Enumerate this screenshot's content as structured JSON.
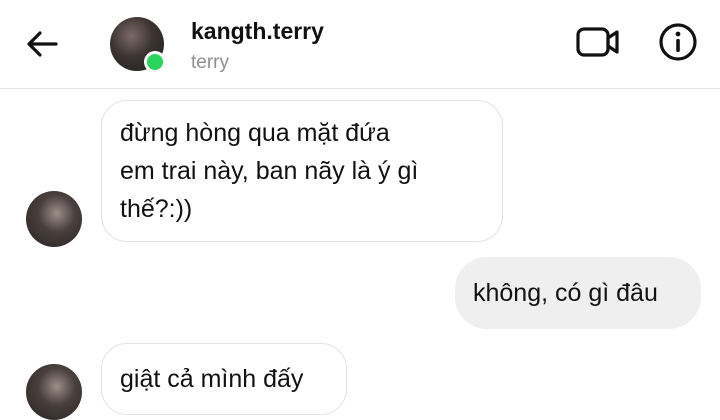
{
  "header": {
    "username": "kangth.terry",
    "subname": "terry",
    "back_icon": "arrow-left-icon",
    "video_icon": "video-camera-icon",
    "info_icon": "info-circle-icon",
    "online_color": "#2bd45a"
  },
  "messages": [
    {
      "direction": "incoming",
      "lines": [
        "đừng hòng qua mặt đứa",
        "em trai này, ban nãy là ý gì",
        "thế?:))"
      ]
    },
    {
      "direction": "outgoing",
      "lines": [
        "không, có gì đâu"
      ]
    },
    {
      "direction": "incoming",
      "lines": [
        "giật cả mình đấy"
      ]
    }
  ]
}
